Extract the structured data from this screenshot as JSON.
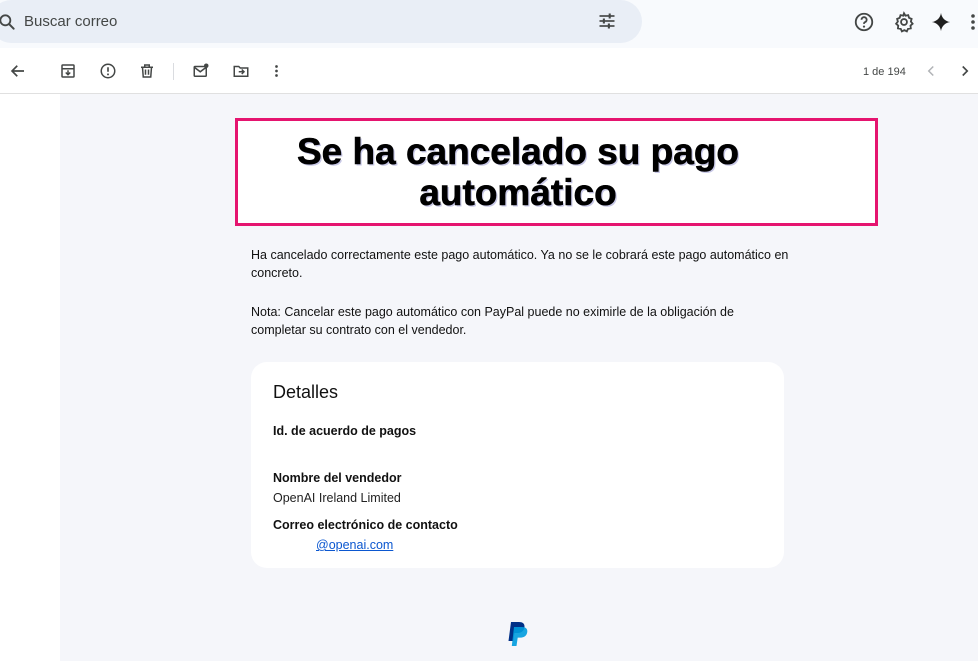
{
  "search": {
    "placeholder": "Buscar correo"
  },
  "topbar": {
    "icons": [
      "help-icon",
      "gear-icon",
      "gemini-sparkle-icon",
      "more-vert-icon"
    ]
  },
  "toolbar": {
    "icons": [
      "back-arrow-icon",
      "archive-icon",
      "report-spam-icon",
      "delete-icon",
      "mark-unread-icon",
      "move-to-icon",
      "more-vert-icon"
    ],
    "page_count": "1 de 194"
  },
  "email": {
    "headline": "Se ha cancelado su pago automático",
    "paragraph1": "Ha cancelado correctamente este pago automático. Ya no se le cobrará este pago automático en concreto.",
    "paragraph2": "Nota: Cancelar este pago automático con PayPal puede no eximirle de la obligación de completar su contrato con el vendedor.",
    "details": {
      "title": "Detalles",
      "agreement_id_label": "Id. de acuerdo de pagos",
      "agreement_id_value": "",
      "seller_name_label": "Nombre del vendedor",
      "seller_name_value": "OpenAI Ireland Limited",
      "contact_email_label": "Correo electrónico de contacto",
      "contact_email_value": "@openai.com"
    }
  },
  "colors": {
    "highlight_border": "#e5146f",
    "link": "#0b57d0",
    "paypal_dark": "#003087",
    "paypal_light": "#009cde"
  }
}
